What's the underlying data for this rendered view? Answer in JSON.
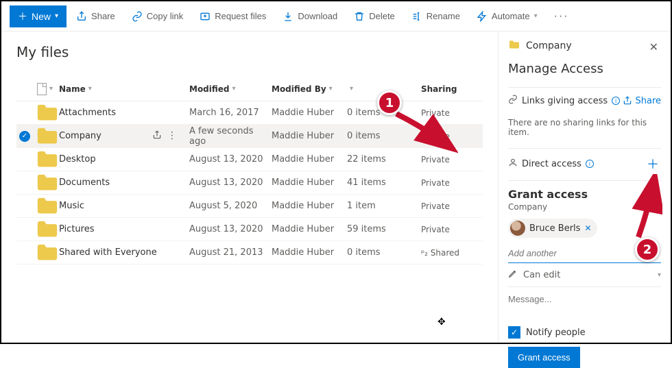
{
  "toolbar": {
    "new_label": "New",
    "share_label": "Share",
    "copy_link_label": "Copy link",
    "request_files_label": "Request files",
    "download_label": "Download",
    "delete_label": "Delete",
    "rename_label": "Rename",
    "automate_label": "Automate"
  },
  "page": {
    "title": "My files"
  },
  "columns": {
    "name": "Name",
    "modified": "Modified",
    "modified_by": "Modified By",
    "file_size": "",
    "sharing": "Sharing"
  },
  "rows": [
    {
      "name": "Attachments",
      "modified": "March 16, 2017",
      "by": "Maddie Huber",
      "size": "0 items",
      "sharing": "Private",
      "selected": false
    },
    {
      "name": "Company",
      "modified": "A few seconds ago",
      "by": "Maddie Huber",
      "size": "0 items",
      "sharing": "Private",
      "selected": true
    },
    {
      "name": "Desktop",
      "modified": "August 13, 2020",
      "by": "Maddie Huber",
      "size": "22 items",
      "sharing": "Private",
      "selected": false
    },
    {
      "name": "Documents",
      "modified": "August 13, 2020",
      "by": "Maddie Huber",
      "size": "41 items",
      "sharing": "Private",
      "selected": false
    },
    {
      "name": "Music",
      "modified": "August 5, 2020",
      "by": "Maddie Huber",
      "size": "1 item",
      "sharing": "Private",
      "selected": false
    },
    {
      "name": "Pictures",
      "modified": "August 13, 2020",
      "by": "Maddie Huber",
      "size": "59 items",
      "sharing": "Private",
      "selected": false
    },
    {
      "name": "Shared with Everyone",
      "modified": "August 21, 2013",
      "by": "Maddie Huber",
      "size": "0 items",
      "sharing": "Shared",
      "selected": false
    }
  ],
  "panel": {
    "folder_name": "Company",
    "heading": "Manage Access",
    "links_section": "Links giving access",
    "share_label": "Share",
    "no_links_text": "There are no sharing links for this item.",
    "direct_access": "Direct access",
    "grant_heading": "Grant access",
    "grant_subhead": "Company",
    "person": "Bruce Berls",
    "add_another_placeholder": "Add another",
    "permission": "Can edit",
    "message_placeholder": "Message...",
    "notify_label": "Notify people",
    "grant_button": "Grant access"
  },
  "callouts": {
    "one": "1",
    "two": "2"
  }
}
